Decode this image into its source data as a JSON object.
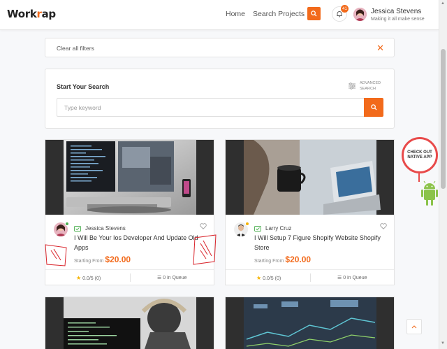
{
  "header": {
    "logo_prefix": "Work",
    "logo_o": "r",
    "logo_suffix": "ap",
    "nav": [
      "Home",
      "Search Projects"
    ],
    "notification_count": "41",
    "user": {
      "name": "Jessica Stevens",
      "tagline": "Making it all make sense"
    }
  },
  "filters": {
    "clear_label": "Clear all filters"
  },
  "search": {
    "title": "Start Your Search",
    "advanced_line1": "ADVANCED",
    "advanced_line2": "SEARCH",
    "placeholder": "Type keyword"
  },
  "cards": [
    {
      "seller": "Jessica Stevens",
      "title": "I Will Be Your Ios Developer And Update Old Apps",
      "price_label": "Starting From",
      "price": "$20.00",
      "rating": "0.0/5 (0)",
      "queue": "0 in Queue",
      "online_color": "#4caf50"
    },
    {
      "seller": "Larry Cruz",
      "title": "I Will Setup 7 Figure Shopify Website Shopify Store",
      "price_label": "Starting From",
      "price": "$20.00",
      "rating": "0.0/5 (0)",
      "queue": "0 in Queue",
      "online_color": "#f5b301"
    }
  ],
  "native_app": {
    "line1": "CHECK OUT",
    "line2": "NATIVE APP"
  },
  "colors": {
    "accent": "#f26a1b",
    "android": "#8bc34a"
  }
}
